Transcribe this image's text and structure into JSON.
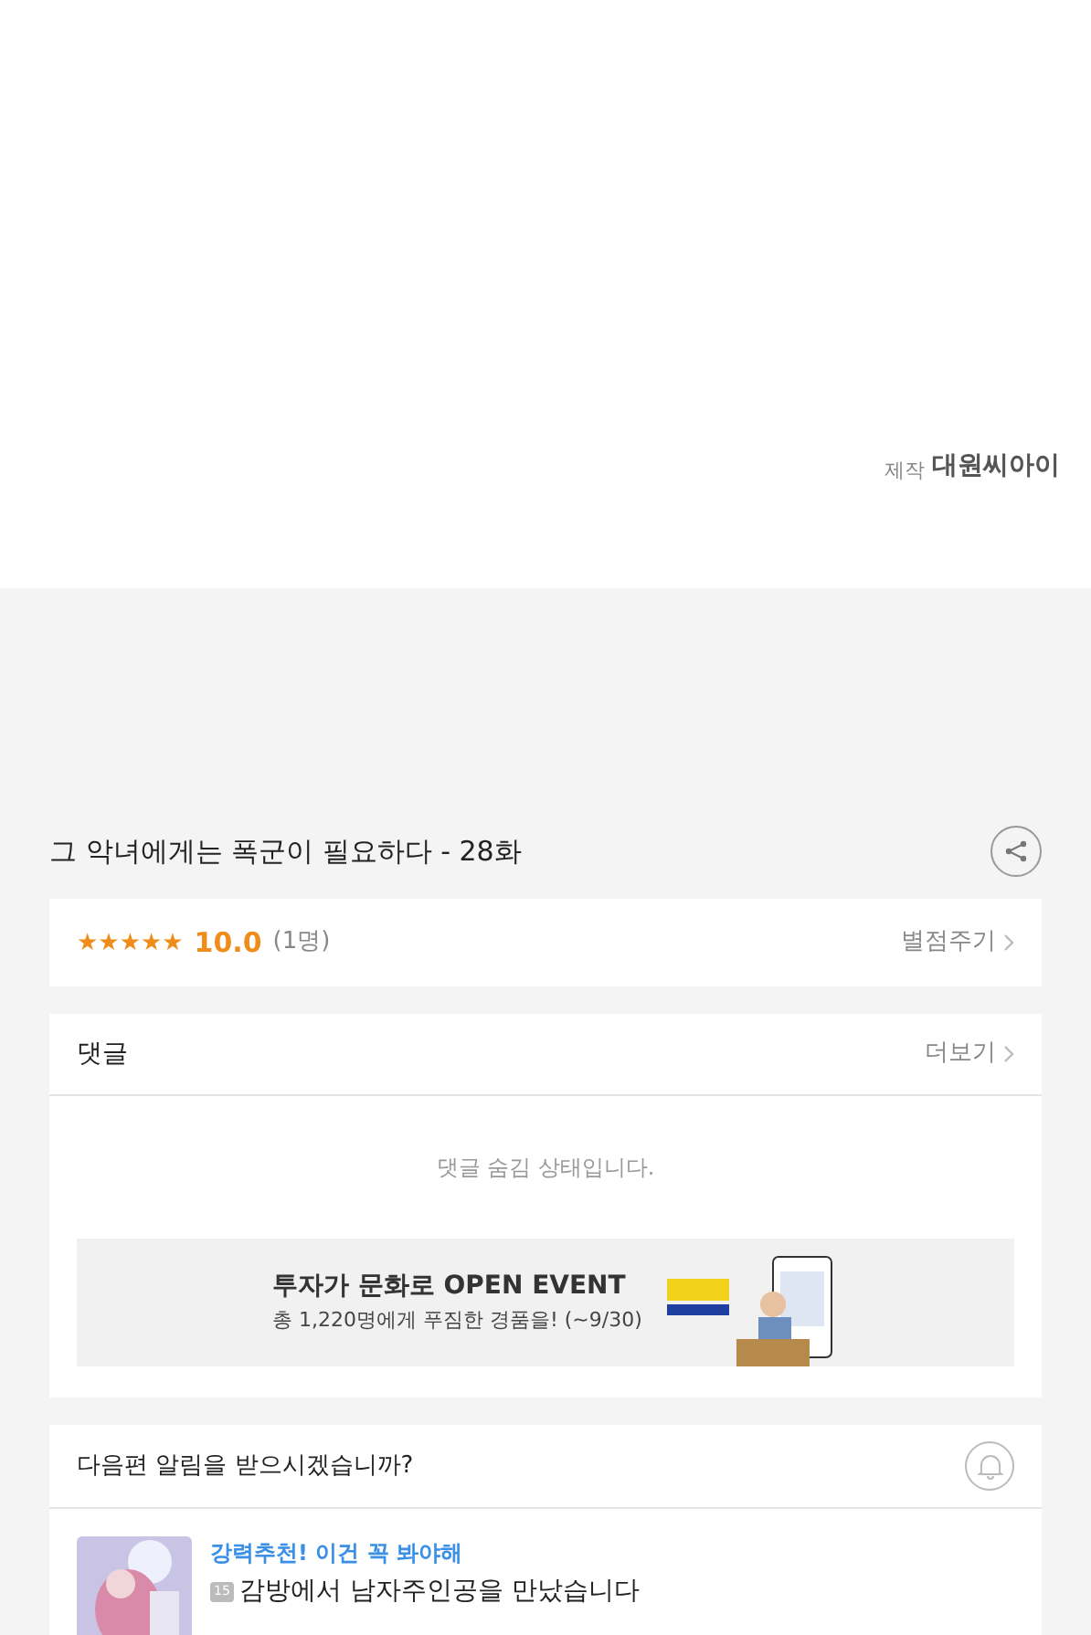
{
  "credit": {
    "label": "제작",
    "studio": "대원씨아이"
  },
  "episode": {
    "title": "그 악녀에게는 폭군이 필요하다 - 28화"
  },
  "rating": {
    "stars": 5,
    "score": "10.0",
    "count": "(1명)",
    "action": "별점주기"
  },
  "comments": {
    "title": "댓글",
    "more": "더보기",
    "notice": "댓글 숨김 상태입니다."
  },
  "ad": {
    "headline": "투자가 문화로 OPEN EVENT",
    "subline": "총 1,220명에게 푸짐한 경품을! (~9/30)"
  },
  "alert": {
    "question": "다음편 알림을 받으시겠습니까?",
    "on": false
  },
  "recommendation": {
    "tagline": "강력추천! 이건 꼭 봐야해",
    "age": "15",
    "title": "감방에서 남자주인공을 만났습니다"
  }
}
